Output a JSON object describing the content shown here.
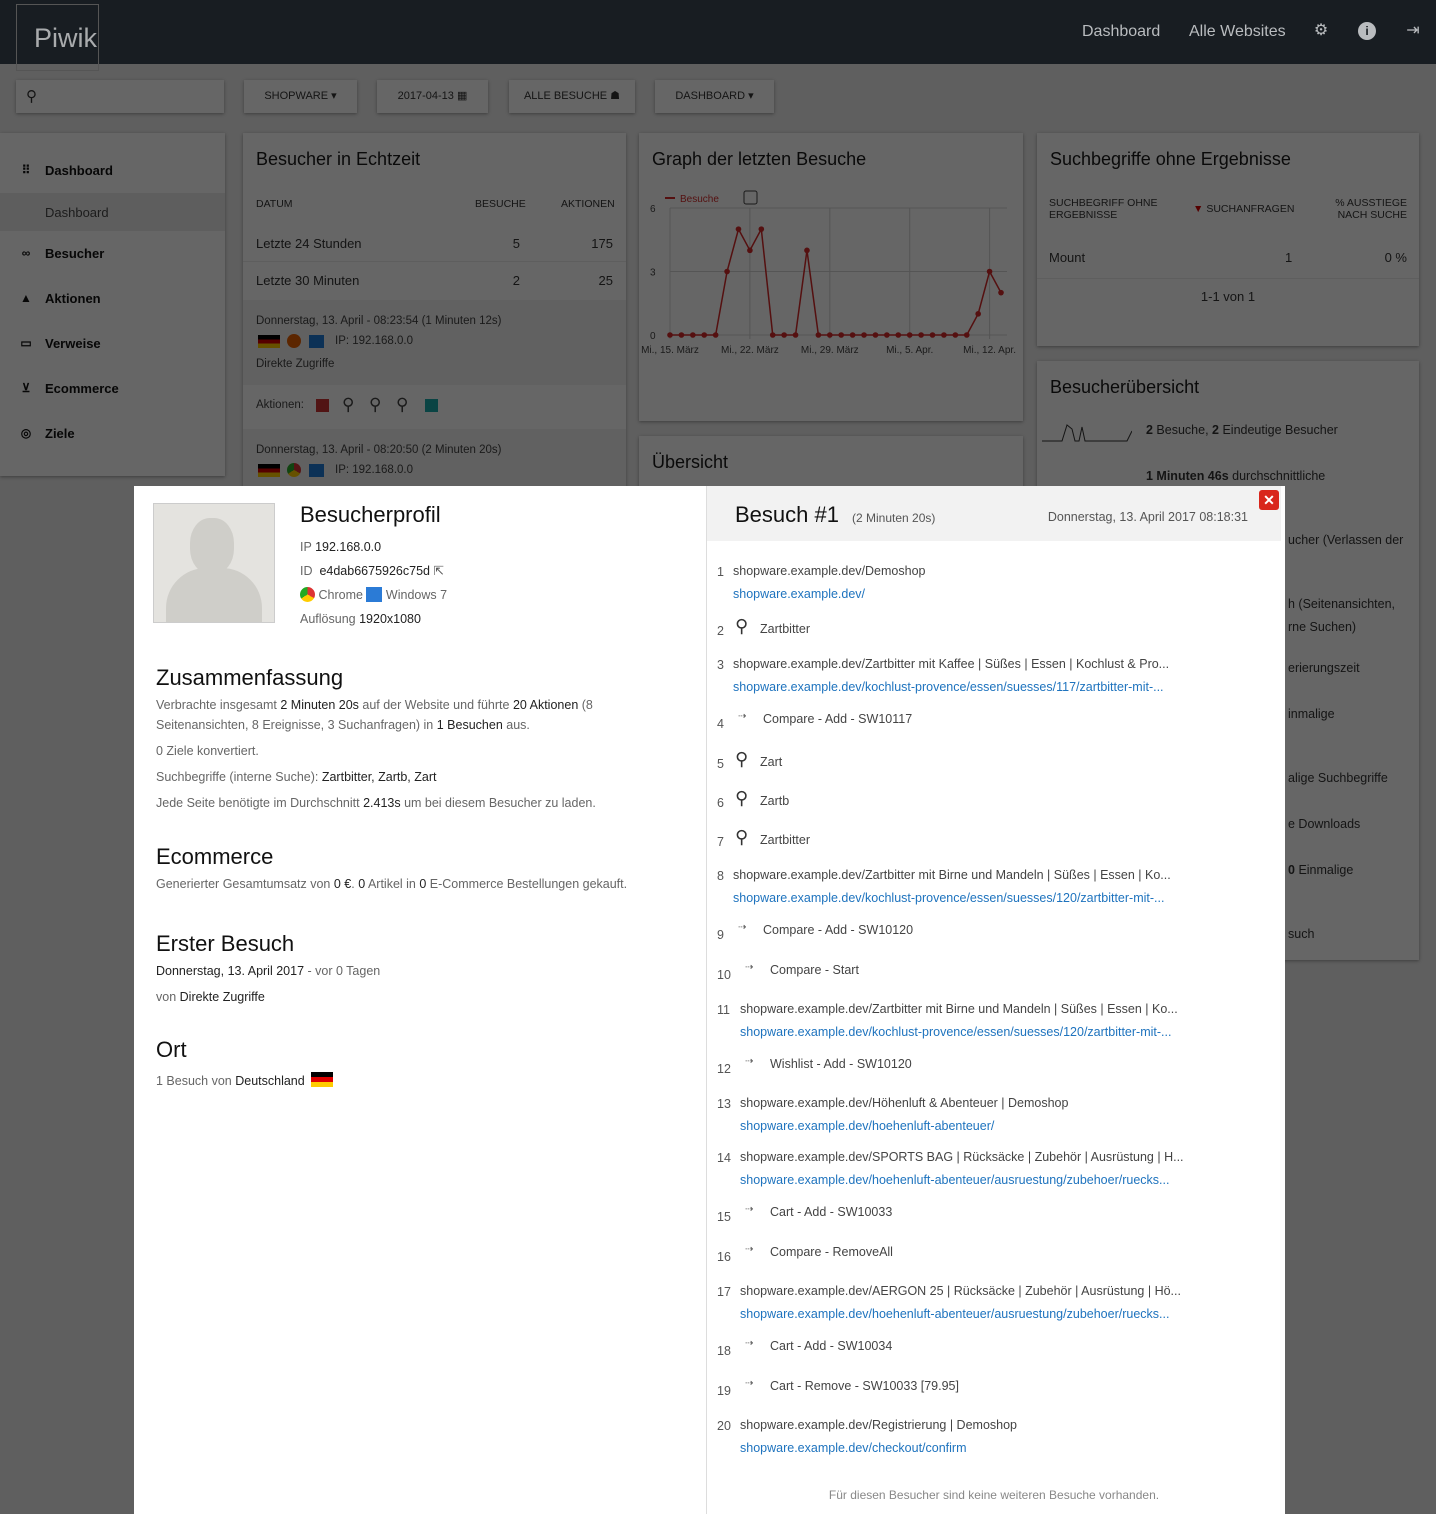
{
  "header": {
    "logo": "Piwik",
    "nav": [
      "Dashboard",
      "Alle Websites"
    ],
    "icons": [
      "gear-icon",
      "info-icon",
      "logout-icon"
    ]
  },
  "toolbar": {
    "search_placeholder": "",
    "site": "SHOPWARE",
    "date": "2017-04-13",
    "segment": "ALLE BESUCHE",
    "dashboard": "DASHBOARD"
  },
  "sidebar": {
    "items": [
      {
        "label": "Dashboard",
        "icon": "grid-icon"
      },
      {
        "label": "Besucher",
        "icon": "binoculars-icon"
      },
      {
        "label": "Aktionen",
        "icon": "bell-icon"
      },
      {
        "label": "Verweise",
        "icon": "window-icon"
      },
      {
        "label": "Ecommerce",
        "icon": "cart-icon"
      },
      {
        "label": "Ziele",
        "icon": "target-icon"
      }
    ],
    "sub_item": "Dashboard"
  },
  "realtime": {
    "title": "Besucher in Echtzeit",
    "cols": [
      "DATUM",
      "BESUCHE",
      "AKTIONEN"
    ],
    "rows": [
      {
        "label": "Letzte 24 Stunden",
        "visits": "5",
        "actions": "175"
      },
      {
        "label": "Letzte 30 Minuten",
        "visits": "2",
        "actions": "25"
      }
    ],
    "visits": [
      {
        "time": "Donnerstag, 13. April - 08:23:54 (1 Minuten 12s)",
        "ip": "IP: 192.168.0.0",
        "referrer": "Direkte Zugriffe",
        "actions_label": "Aktionen:"
      },
      {
        "time": "Donnerstag, 13. April - 08:20:50 (2 Minuten 20s)",
        "ip": "IP: 192.168.0.0"
      }
    ]
  },
  "graph": {
    "title": "Graph der letzten Besuche"
  },
  "chart_data": {
    "type": "line",
    "x": [
      "2017-03-15",
      "2017-03-16",
      "2017-03-17",
      "2017-03-18",
      "2017-03-19",
      "2017-03-20",
      "2017-03-21",
      "2017-03-22",
      "2017-03-23",
      "2017-03-24",
      "2017-03-25",
      "2017-03-26",
      "2017-03-27",
      "2017-03-28",
      "2017-03-29",
      "2017-03-30",
      "2017-03-31",
      "2017-04-01",
      "2017-04-02",
      "2017-04-03",
      "2017-04-04",
      "2017-04-05",
      "2017-04-06",
      "2017-04-07",
      "2017-04-08",
      "2017-04-09",
      "2017-04-10",
      "2017-04-11",
      "2017-04-12",
      "2017-04-13"
    ],
    "series": [
      {
        "name": "Besuche",
        "values": [
          0,
          0,
          0,
          0,
          0,
          3,
          5,
          4,
          5,
          0,
          0,
          0,
          4,
          0,
          0,
          0,
          0,
          0,
          0,
          0,
          0,
          0,
          0,
          0,
          0,
          0,
          0,
          1,
          3,
          2
        ],
        "color": "#d4291f"
      }
    ],
    "yticks": [
      "0",
      "3",
      "6"
    ],
    "ylim": [
      0,
      6
    ],
    "xticks": [
      "Mi., 15. März",
      "Mi., 22. März",
      "Mi., 29. März",
      "Mi., 5. Apr.",
      "Mi., 12. Apr."
    ],
    "grid": true,
    "legend": "top-left"
  },
  "overview": {
    "title": "Übersicht"
  },
  "nosearch": {
    "title": "Suchbegriffe ohne Ergebnisse",
    "cols": [
      "SUCHBEGRIFF OHNE ERGEBNISSE",
      "SUCHANFRAGEN",
      "% AUSSTIEGE NACH SUCHE"
    ],
    "rows": [
      {
        "term": "Mount",
        "count": "1",
        "exit": "0 %"
      }
    ],
    "pagination": "1-1 von 1"
  },
  "visitor_overview": {
    "title": "Besucherübersicht",
    "line1": {
      "n1": "2",
      "t1": " Besuche, ",
      "n2": "2",
      "t2": " Eindeutige Besucher"
    },
    "line2": {
      "n": "1 Minuten 46s",
      "t": " durchschnittliche"
    },
    "clipped": [
      "ucher (Verlassen der",
      "h (Seitenansichten,",
      "rne Suchen)",
      "erierungszeit",
      "inmalige",
      "alige Suchbegriffe",
      "e Downloads",
      "0",
      "Einmalige",
      "such"
    ]
  },
  "profile": {
    "title": "Besucherprofil",
    "ip_label": "IP",
    "ip": "192.168.0.0",
    "id_label": "ID",
    "id": "e4dab6675926c75d",
    "browser": "Chrome",
    "os": "Windows 7",
    "res_label": "Auflösung",
    "res": "1920x1080",
    "summary_title": "Zusammenfassung",
    "summary": {
      "a": "Verbrachte insgesamt ",
      "b": "2 Minuten 20s",
      "c": " auf der Website und führte ",
      "d": "20 Aktionen",
      "e": " (8 Seitenansichten, 8 Ereignisse, 3 Suchanfragen) in ",
      "f": "1",
      "g": " ",
      "h": "Besuchen",
      "i": " aus."
    },
    "goals": "0 Ziele konvertiert.",
    "keywords_label": "Suchbegriffe (interne Suche): ",
    "keywords": "Zartbitter, Zartb, Zart",
    "load_a": "Jede Seite benötigte im Durchschnitt ",
    "load_b": "2.413s",
    "load_c": " um bei diesem Besucher zu laden.",
    "ecom_title": "Ecommerce",
    "ecom_a": "Generierter Gesamtumsatz von ",
    "ecom_b": "0 €",
    "ecom_c": ". ",
    "ecom_d": "0",
    "ecom_e": " Artikel in ",
    "ecom_f": "0",
    "ecom_g": " E-Commerce Bestellungen gekauft.",
    "first_title": "Erster Besuch",
    "first_date": "Donnerstag, 13. April 2017",
    "first_ago": " - vor 0 Tagen",
    "first_from": "von ",
    "first_ref": "Direkte Zugriffe",
    "loc_title": "Ort",
    "loc_a": "1 Besuch von ",
    "loc_b": "Deutschland"
  },
  "visit": {
    "title": "Besuch #1",
    "duration": "(2 Minuten 20s)",
    "date": "Donnerstag, 13. April 2017 08:18:31",
    "actions": [
      {
        "n": "1",
        "type": "page",
        "title": "shopware.example.dev/Demoshop",
        "url": "shopware.example.dev/"
      },
      {
        "n": "2",
        "type": "search",
        "title": "Zartbitter"
      },
      {
        "n": "3",
        "type": "page",
        "title": "shopware.example.dev/Zartbitter mit Kaffee | Süßes | Essen | Kochlust & Pro...",
        "url": "shopware.example.dev/kochlust-provence/essen/suesses/117/zartbitter-mit-..."
      },
      {
        "n": "4",
        "type": "event",
        "title": "Compare - Add - SW10117"
      },
      {
        "n": "5",
        "type": "search",
        "title": "Zart"
      },
      {
        "n": "6",
        "type": "search",
        "title": "Zartb"
      },
      {
        "n": "7",
        "type": "search",
        "title": "Zartbitter"
      },
      {
        "n": "8",
        "type": "page",
        "title": "shopware.example.dev/Zartbitter mit Birne und Mandeln | Süßes | Essen | Ko...",
        "url": "shopware.example.dev/kochlust-provence/essen/suesses/120/zartbitter-mit-..."
      },
      {
        "n": "9",
        "type": "event",
        "title": "Compare - Add - SW10120"
      },
      {
        "n": "10",
        "type": "event",
        "title": "Compare - Start"
      },
      {
        "n": "11",
        "type": "page",
        "title": "shopware.example.dev/Zartbitter mit Birne und Mandeln | Süßes | Essen | Ko...",
        "url": "shopware.example.dev/kochlust-provence/essen/suesses/120/zartbitter-mit-..."
      },
      {
        "n": "12",
        "type": "event",
        "title": "Wishlist - Add - SW10120"
      },
      {
        "n": "13",
        "type": "page",
        "title": "shopware.example.dev/Höhenluft & Abenteuer | Demoshop",
        "url": "shopware.example.dev/hoehenluft-abenteuer/"
      },
      {
        "n": "14",
        "type": "page",
        "title": "shopware.example.dev/SPORTS BAG | Rücksäcke | Zubehör | Ausrüstung | H...",
        "url": "shopware.example.dev/hoehenluft-abenteuer/ausruestung/zubehoer/ruecks..."
      },
      {
        "n": "15",
        "type": "event",
        "title": "Cart - Add - SW10033"
      },
      {
        "n": "16",
        "type": "event",
        "title": "Compare - RemoveAll"
      },
      {
        "n": "17",
        "type": "page",
        "title": "shopware.example.dev/AERGON 25 | Rücksäcke | Zubehör | Ausrüstung | Hö...",
        "url": "shopware.example.dev/hoehenluft-abenteuer/ausruestung/zubehoer/ruecks..."
      },
      {
        "n": "18",
        "type": "event",
        "title": "Cart - Add - SW10034"
      },
      {
        "n": "19",
        "type": "event",
        "title": "Cart - Remove - SW10033 [79.95]"
      },
      {
        "n": "20",
        "type": "page",
        "title": "shopware.example.dev/Registrierung | Demoshop",
        "url": "shopware.example.dev/checkout/confirm"
      }
    ],
    "footer": "Für diesen Besucher sind keine weiteren Besuche vorhanden."
  }
}
